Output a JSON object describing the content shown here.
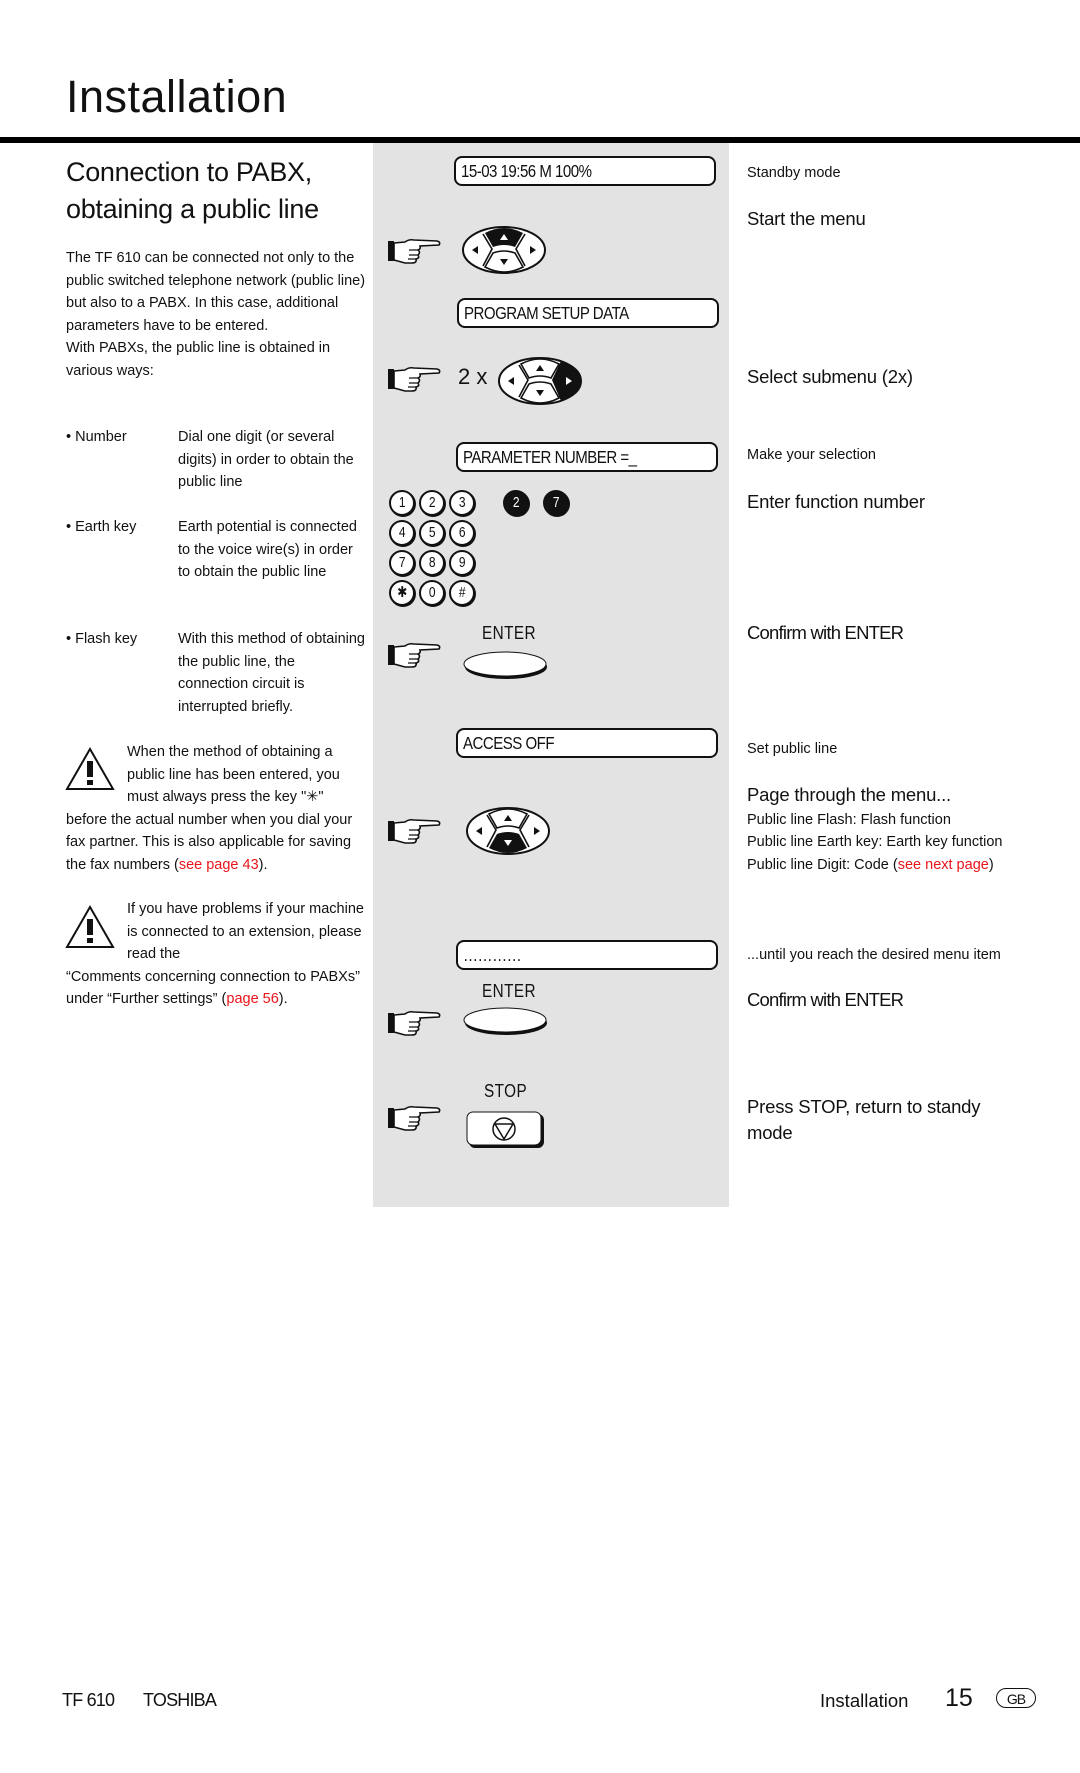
{
  "page": {
    "title": "Installation",
    "section_title_line1": "Connection to PABX,",
    "section_title_line2": "obtaining a public line"
  },
  "intro": {
    "paragraph1": "The TF 610 can be connected not only to the public switched telephone network (public line) but also to a PABX. In this case, additional parameters have to be entered.",
    "paragraph2": "With PABXs, the public line is obtained in various ways:"
  },
  "methods": [
    {
      "label": "• Number",
      "description": "Dial one digit (or several digits) in order to obtain the public line"
    },
    {
      "label": "• Earth key",
      "description": "Earth potential is connected to the voice wire(s) in order to obtain the public line"
    },
    {
      "label": "• Flash key",
      "description": "With this method of obtaining the public line, the connection circuit is interrupted briefly."
    }
  ],
  "warnings": [
    {
      "indented": "When the method of obtaining a public line has been entered, you must always press the key \"✳\"",
      "rest_before_link": "before the actual number when you dial your fax partner. This is also applicable for saving the fax numbers (",
      "link": "see page 43",
      "rest_after_link": ")."
    },
    {
      "indented": "If you have problems if your machine is connected to an extension, please read the",
      "rest_before_link": "“Comments concerning connection to PABXs” under “Further settings” (",
      "link": "page 56",
      "rest_after_link": ")."
    }
  ],
  "device": {
    "displays": [
      "15-03 19:56  M 100%",
      "PROGRAM SETUP DATA",
      "PARAMETER NUMBER =_",
      "ACCESS OFF",
      "…………"
    ],
    "repeat_label": "2 x",
    "keypad": [
      "1",
      "2",
      "3",
      "4",
      "5",
      "6",
      "7",
      "8",
      "9",
      "✱",
      "0",
      "#"
    ],
    "entered_digits": [
      "2",
      "7"
    ],
    "enter_label": "ENTER",
    "stop_label": "STOP"
  },
  "steps": {
    "standby": "Standby mode",
    "start_menu": "Start the menu",
    "select_submenu": "Select submenu (2x)",
    "make_selection": "Make your selection",
    "enter_function": "Enter function number",
    "confirm_enter_1": "Confirm with ENTER",
    "set_public_line": "Set public line",
    "page_through": "Page through the menu...",
    "options": [
      "Public line Flash: Flash function",
      "Public line Earth key: Earth key function"
    ],
    "option_digit_before": "Public line Digit: Code (",
    "option_digit_link": "see next page",
    "option_digit_after": ")",
    "until": "...until you reach the desired menu item",
    "confirm_enter_2": "Confirm with ENTER",
    "press_stop": "Press STOP, return to standy mode"
  },
  "footer": {
    "model": "TF 610",
    "brand": "TOSHIBA",
    "section": "Installation",
    "page_number": "15",
    "language_badge": "GB"
  },
  "colors": {
    "link": "#e8141a",
    "panel": "#e3e3e3"
  }
}
